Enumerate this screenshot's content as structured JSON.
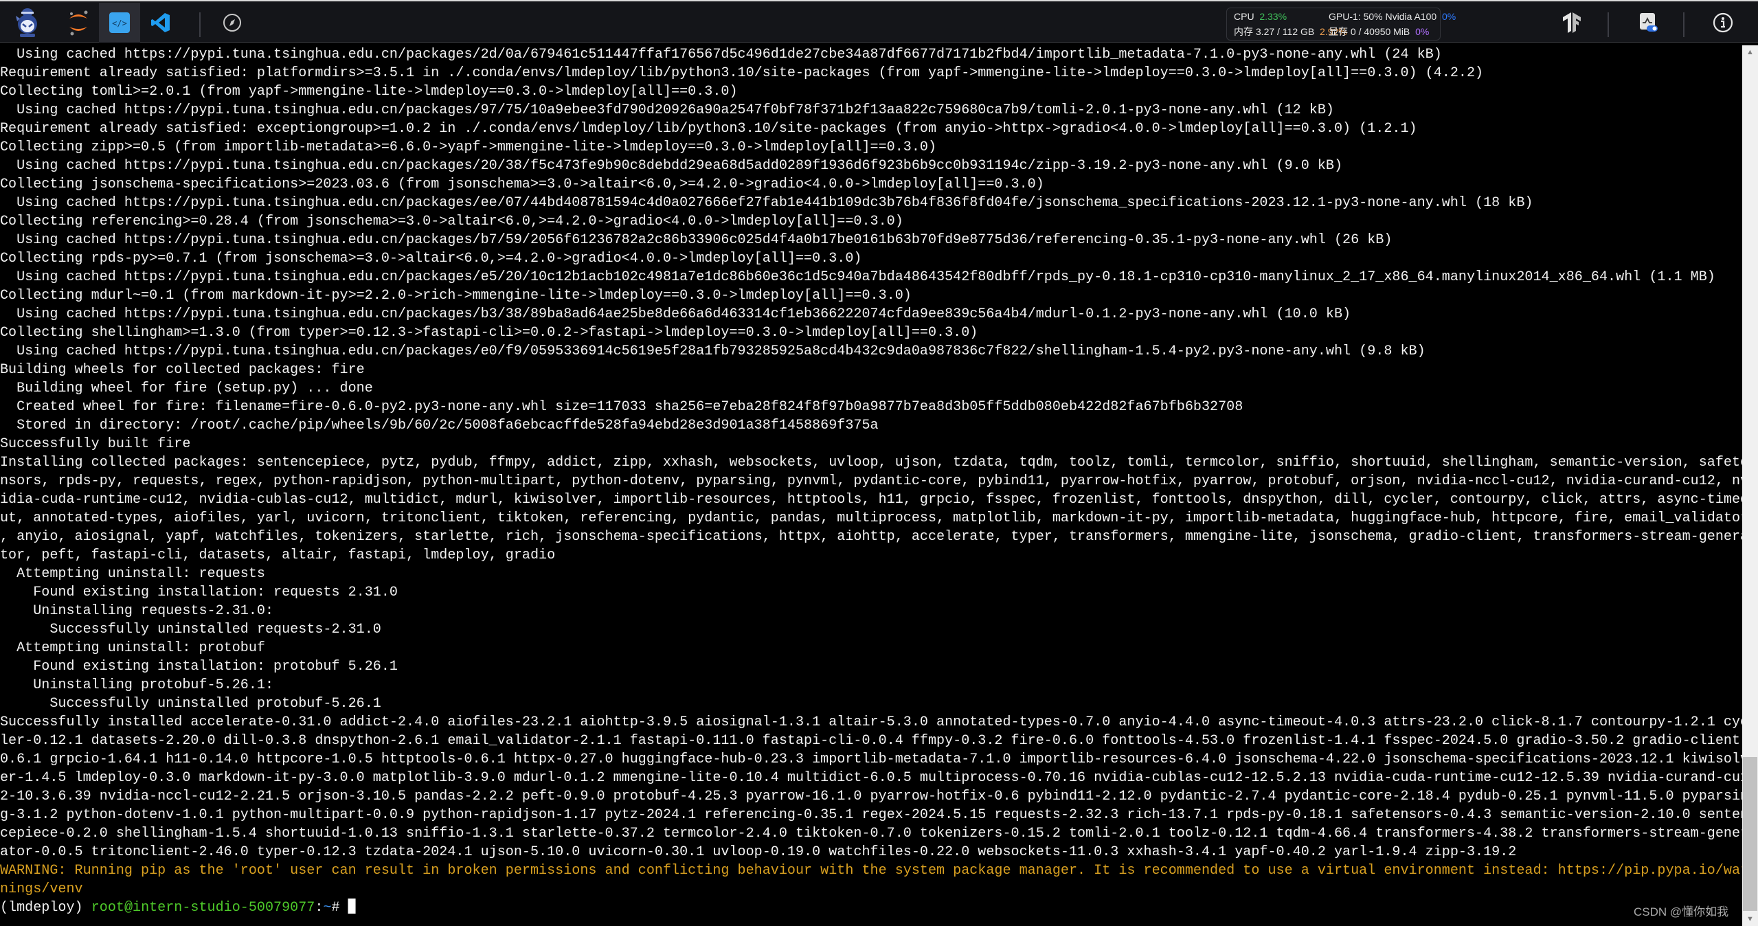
{
  "toolbar": {
    "left_icons": [
      {
        "name": "app-logo-icon"
      },
      {
        "name": "jupyter-icon"
      },
      {
        "name": "code-editor-icon"
      },
      {
        "name": "vscode-icon"
      },
      {
        "name": "compass-icon"
      }
    ],
    "stats": {
      "cpu_label": "CPU",
      "cpu_value": "2.33%",
      "mem_label": "内存 3.27 / 112 GB",
      "mem_value": "2.92%",
      "gpu_label": "GPU-1: 50% Nvidia A100",
      "gpu_value": "0%",
      "vram_label": "显存 0 / 40950 MiB",
      "vram_value": "0%"
    },
    "right_icons": [
      {
        "name": "tensorflow-icon"
      },
      {
        "name": "monitor-toggle-icon"
      },
      {
        "name": "info-icon"
      }
    ]
  },
  "terminal": {
    "lines": [
      {
        "text": "  Using cached https://pypi.tuna.tsinghua.edu.cn/packages/2d/0a/679461c511447ffaf176567d5c496d1de27cbe34a87df6677d7171b2fbd4/importlib_metadata-7.1.0-py3-none-any.whl (24 kB)"
      },
      {
        "text": "Requirement already satisfied: platformdirs>=3.5.1 in ./.conda/envs/lmdeploy/lib/python3.10/site-packages (from yapf->mmengine-lite->lmdeploy==0.3.0->lmdeploy[all]==0.3.0) (4.2.2)"
      },
      {
        "text": "Collecting tomli>=2.0.1 (from yapf->mmengine-lite->lmdeploy==0.3.0->lmdeploy[all]==0.3.0)"
      },
      {
        "text": "  Using cached https://pypi.tuna.tsinghua.edu.cn/packages/97/75/10a9ebee3fd790d20926a90a2547f0bf78f371b2f13aa822c759680ca7b9/tomli-2.0.1-py3-none-any.whl (12 kB)"
      },
      {
        "text": "Requirement already satisfied: exceptiongroup>=1.0.2 in ./.conda/envs/lmdeploy/lib/python3.10/site-packages (from anyio->httpx->gradio<4.0.0->lmdeploy[all]==0.3.0) (1.2.1)"
      },
      {
        "text": "Collecting zipp>=0.5 (from importlib-metadata>=6.6.0->yapf->mmengine-lite->lmdeploy==0.3.0->lmdeploy[all]==0.3.0)"
      },
      {
        "text": "  Using cached https://pypi.tuna.tsinghua.edu.cn/packages/20/38/f5c473fe9b90c8debdd29ea68d5add0289f1936d6f923b6b9cc0b931194c/zipp-3.19.2-py3-none-any.whl (9.0 kB)"
      },
      {
        "text": "Collecting jsonschema-specifications>=2023.03.6 (from jsonschema>=3.0->altair<6.0,>=4.2.0->gradio<4.0.0->lmdeploy[all]==0.3.0)"
      },
      {
        "text": "  Using cached https://pypi.tuna.tsinghua.edu.cn/packages/ee/07/44bd408781594c4d0a027666ef27fab1e441b109dc3b76b4f836f8fd04fe/jsonschema_specifications-2023.12.1-py3-none-any.whl (18 kB)"
      },
      {
        "text": "Collecting referencing>=0.28.4 (from jsonschema>=3.0->altair<6.0,>=4.2.0->gradio<4.0.0->lmdeploy[all]==0.3.0)"
      },
      {
        "text": "  Using cached https://pypi.tuna.tsinghua.edu.cn/packages/b7/59/2056f61236782a2c86b33906c025d4f4a0b17be0161b63b70fd9e8775d36/referencing-0.35.1-py3-none-any.whl (26 kB)"
      },
      {
        "text": "Collecting rpds-py>=0.7.1 (from jsonschema>=3.0->altair<6.0,>=4.2.0->gradio<4.0.0->lmdeploy[all]==0.3.0)"
      },
      {
        "text": "  Using cached https://pypi.tuna.tsinghua.edu.cn/packages/e5/20/10c12b1acb102c4981a7e1dc86b60e36c1d5c940a7bda48643542f80dbff/rpds_py-0.18.1-cp310-cp310-manylinux_2_17_x86_64.manylinux2014_x86_64.whl (1.1 MB)"
      },
      {
        "text": "Collecting mdurl~=0.1 (from markdown-it-py>=2.2.0->rich->mmengine-lite->lmdeploy==0.3.0->lmdeploy[all]==0.3.0)"
      },
      {
        "text": "  Using cached https://pypi.tuna.tsinghua.edu.cn/packages/b3/38/89ba8ad64ae25be8de66a6d463314cf1eb366222074cfda9ee839c56a4b4/mdurl-0.1.2-py3-none-any.whl (10.0 kB)"
      },
      {
        "text": "Collecting shellingham>=1.3.0 (from typer>=0.12.3->fastapi-cli>=0.0.2->fastapi->lmdeploy==0.3.0->lmdeploy[all]==0.3.0)"
      },
      {
        "text": "  Using cached https://pypi.tuna.tsinghua.edu.cn/packages/e0/f9/0595336914c5619e5f28a1fb793285925a8cd4b432c9da0a987836c7f822/shellingham-1.5.4-py2.py3-none-any.whl (9.8 kB)"
      },
      {
        "text": "Building wheels for collected packages: fire"
      },
      {
        "text": "  Building wheel for fire (setup.py) ... done"
      },
      {
        "text": "  Created wheel for fire: filename=fire-0.6.0-py2.py3-none-any.whl size=117033 sha256=e7eba28f824f8f97b0a9877b7ea8d3b05ff5ddb080eb422d82fa67bfb6b32708"
      },
      {
        "text": "  Stored in directory: /root/.cache/pip/wheels/9b/60/2c/5008fa6ebcacffde528fa94ebd28e3d901a38f1458869f375a"
      },
      {
        "text": "Successfully built fire"
      },
      {
        "text": "Installing collected packages: sentencepiece, pytz, pydub, ffmpy, addict, zipp, xxhash, websockets, uvloop, ujson, tzdata, tqdm, toolz, tomli, termcolor, sniffio, shortuuid, shellingham, semantic-version, safete"
      },
      {
        "text": "nsors, rpds-py, requests, regex, python-rapidjson, python-multipart, python-dotenv, pyparsing, pynvml, pydantic-core, pybind11, pyarrow-hotfix, pyarrow, protobuf, orjson, nvidia-nccl-cu12, nvidia-curand-cu12, nv"
      },
      {
        "text": "idia-cuda-runtime-cu12, nvidia-cublas-cu12, multidict, mdurl, kiwisolver, importlib-resources, httptools, h11, grpcio, fsspec, frozenlist, fonttools, dnspython, dill, cycler, contourpy, click, attrs, async-timeo"
      },
      {
        "text": "ut, annotated-types, aiofiles, yarl, uvicorn, tritonclient, tiktoken, referencing, pydantic, pandas, multiprocess, matplotlib, markdown-it-py, importlib-metadata, huggingface-hub, httpcore, fire, email_validator"
      },
      {
        "text": ", anyio, aiosignal, yapf, watchfiles, tokenizers, starlette, rich, jsonschema-specifications, httpx, aiohttp, accelerate, typer, transformers, mmengine-lite, jsonschema, gradio-client, transformers-stream-genera"
      },
      {
        "text": "tor, peft, fastapi-cli, datasets, altair, fastapi, lmdeploy, gradio"
      },
      {
        "text": "  Attempting uninstall: requests"
      },
      {
        "text": "    Found existing installation: requests 2.31.0"
      },
      {
        "text": "    Uninstalling requests-2.31.0:"
      },
      {
        "text": "      Successfully uninstalled requests-2.31.0"
      },
      {
        "text": "  Attempting uninstall: protobuf"
      },
      {
        "text": "    Found existing installation: protobuf 5.26.1"
      },
      {
        "text": "    Uninstalling protobuf-5.26.1:"
      },
      {
        "text": "      Successfully uninstalled protobuf-5.26.1"
      },
      {
        "text": "Successfully installed accelerate-0.31.0 addict-2.4.0 aiofiles-23.2.1 aiohttp-3.9.5 aiosignal-1.3.1 altair-5.3.0 annotated-types-0.7.0 anyio-4.4.0 async-timeout-4.0.3 attrs-23.2.0 click-8.1.7 contourpy-1.2.1 cyc"
      },
      {
        "text": "ler-0.12.1 datasets-2.20.0 dill-0.3.8 dnspython-2.6.1 email_validator-2.1.1 fastapi-0.111.0 fastapi-cli-0.0.4 ffmpy-0.3.2 fire-0.6.0 fonttools-4.53.0 frozenlist-1.4.1 fsspec-2024.5.0 gradio-3.50.2 gradio-client-"
      },
      {
        "text": "0.6.1 grpcio-1.64.1 h11-0.14.0 httpcore-1.0.5 httptools-0.6.1 httpx-0.27.0 huggingface-hub-0.23.3 importlib-metadata-7.1.0 importlib-resources-6.4.0 jsonschema-4.22.0 jsonschema-specifications-2023.12.1 kiwisolv"
      },
      {
        "text": "er-1.4.5 lmdeploy-0.3.0 markdown-it-py-3.0.0 matplotlib-3.9.0 mdurl-0.1.2 mmengine-lite-0.10.4 multidict-6.0.5 multiprocess-0.70.16 nvidia-cublas-cu12-12.5.2.13 nvidia-cuda-runtime-cu12-12.5.39 nvidia-curand-cu1"
      },
      {
        "text": "2-10.3.6.39 nvidia-nccl-cu12-2.21.5 orjson-3.10.5 pandas-2.2.2 peft-0.9.0 protobuf-4.25.3 pyarrow-16.1.0 pyarrow-hotfix-0.6 pybind11-2.12.0 pydantic-2.7.4 pydantic-core-2.18.4 pydub-0.25.1 pynvml-11.5.0 pyparsin"
      },
      {
        "text": "g-3.1.2 python-dotenv-1.0.1 python-multipart-0.0.9 python-rapidjson-1.17 pytz-2024.1 referencing-0.35.1 regex-2024.5.15 requests-2.32.3 rich-13.7.1 rpds-py-0.18.1 safetensors-0.4.3 semantic-version-2.10.0 senten"
      },
      {
        "text": "cepiece-0.2.0 shellingham-1.5.4 shortuuid-1.0.13 sniffio-1.3.1 starlette-0.37.2 termcolor-2.4.0 tiktoken-0.7.0 tokenizers-0.15.2 tomli-2.0.1 toolz-0.12.1 tqdm-4.66.4 transformers-4.38.2 transformers-stream-gener"
      },
      {
        "text": "ator-0.0.5 tritonclient-2.46.0 typer-0.12.3 tzdata-2024.1 ujson-5.10.0 uvicorn-0.30.1 uvloop-0.19.0 watchfiles-0.22.0 websockets-11.0.3 xxhash-3.4.1 yapf-0.40.2 yarl-1.9.4 zipp-3.19.2"
      },
      {
        "text": "WARNING: Running pip as the 'root' user can result in broken permissions and conflicting behaviour with the system package manager. It is recommended to use a virtual environment instead: https://pip.pypa.io/war",
        "style": "warning"
      },
      {
        "text": "nings/venv",
        "style": "warning"
      }
    ],
    "prompt": {
      "env": "(lmdeploy) ",
      "user_host": "root@intern-studio-50079077",
      "colon": ":",
      "path": "~",
      "symbol": "# "
    },
    "colors": {
      "foreground": "#f2f2f2",
      "background": "#000000",
      "warning": "#d9a020",
      "prompt_user": "#4ec92a",
      "prompt_path": "#3b8eea"
    }
  },
  "scrollbar": {
    "up_arrow": "▲",
    "down_arrow": "▼"
  },
  "watermark": "CSDN @懂你如我"
}
